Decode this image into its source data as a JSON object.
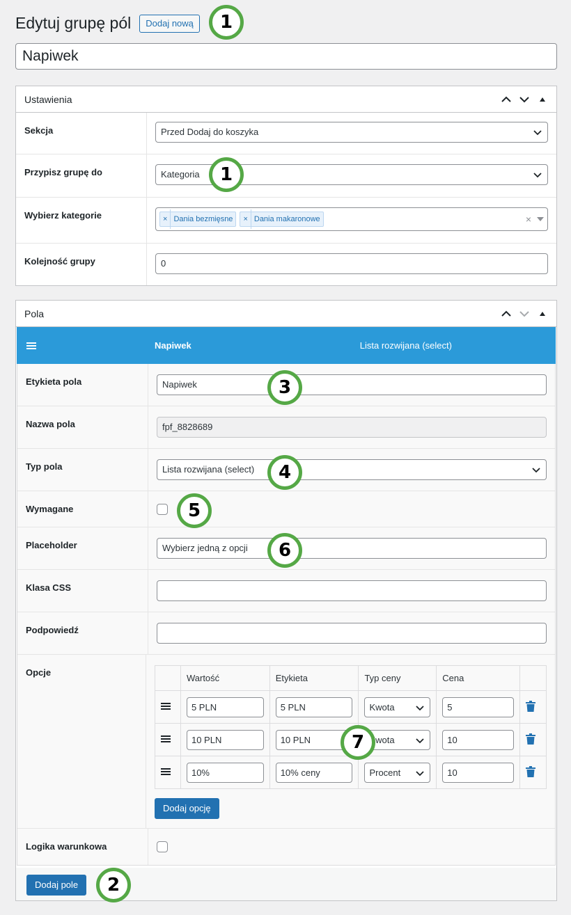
{
  "header": {
    "title": "Edytuj grupę pól",
    "add_new_label": "Dodaj nową"
  },
  "group_title_value": "Napiwek",
  "settings": {
    "title": "Ustawienia",
    "rows": {
      "section": {
        "label": "Sekcja",
        "value": "Przed Dodaj do koszyka"
      },
      "assign": {
        "label": "Przypisz grupę do",
        "value": "Kategoria"
      },
      "categories": {
        "label": "Wybierz kategorie",
        "tags": [
          "Dania bezmięsne",
          "Dania makaronowe"
        ]
      },
      "order": {
        "label": "Kolejność grupy",
        "value": "0"
      }
    }
  },
  "fields": {
    "title": "Pola",
    "bar": {
      "name": "Napiwek",
      "type": "Lista rozwijana (select)"
    },
    "rows": {
      "label": {
        "label": "Etykieta pola",
        "value": "Napiwek"
      },
      "name": {
        "label": "Nazwa pola",
        "value": "fpf_8828689"
      },
      "type": {
        "label": "Typ pola",
        "value": "Lista rozwijana (select)"
      },
      "required": {
        "label": "Wymagane",
        "checked": false
      },
      "placeholder": {
        "label": "Placeholder",
        "value": "Wybierz jedną z opcji"
      },
      "css": {
        "label": "Klasa CSS",
        "value": ""
      },
      "hint": {
        "label": "Podpowiedź",
        "value": ""
      },
      "options": {
        "label": "Opcje",
        "columns": [
          "Wartość",
          "Etykieta",
          "Typ ceny",
          "Cena"
        ],
        "rows": [
          {
            "value": "5 PLN",
            "label": "5 PLN",
            "price_type": "Kwota",
            "price": "5"
          },
          {
            "value": "10 PLN",
            "label": "10 PLN",
            "price_type": "Kwota",
            "price": "10"
          },
          {
            "value": "10%",
            "label": "10% ceny",
            "price_type": "Procent",
            "price": "10"
          }
        ],
        "add_option_label": "Dodaj opcję"
      },
      "logic": {
        "label": "Logika warunkowa",
        "checked": false
      }
    }
  },
  "footer": {
    "add_field_label": "Dodaj pole"
  },
  "badges": [
    "1",
    "1",
    "3",
    "4",
    "5",
    "6",
    "7",
    "2"
  ],
  "colors": {
    "accent": "#2271b1",
    "bar": "#2b9ad9",
    "badge_ring": "#55a846"
  }
}
